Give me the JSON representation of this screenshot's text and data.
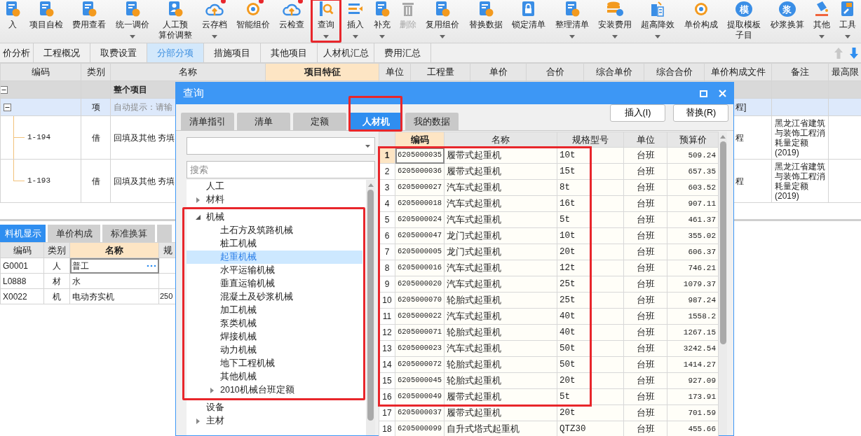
{
  "toolbar": [
    {
      "lines": [
        "入"
      ],
      "kind": "document",
      "dropdown": false,
      "disabled": false,
      "alert": false,
      "highlighted": false
    },
    {
      "lines": [
        "项目自检"
      ],
      "kind": "document",
      "dropdown": false,
      "disabled": false,
      "alert": false,
      "highlighted": false
    },
    {
      "lines": [
        "费用查看"
      ],
      "kind": "document",
      "dropdown": false,
      "disabled": false,
      "alert": false,
      "highlighted": false
    },
    {
      "lines": [
        "统一调价"
      ],
      "kind": "document",
      "dropdown": true,
      "disabled": false,
      "alert": false,
      "highlighted": false
    },
    {
      "lines": [
        "人工预",
        "算价调整"
      ],
      "kind": "person",
      "dropdown": false,
      "disabled": false,
      "alert": false,
      "highlighted": false
    },
    {
      "lines": [
        "云存档"
      ],
      "kind": "cloud",
      "dropdown": true,
      "disabled": false,
      "alert": true,
      "highlighted": false
    },
    {
      "lines": [
        "智能组价"
      ],
      "kind": "coin",
      "dropdown": false,
      "disabled": false,
      "alert": true,
      "highlighted": false
    },
    {
      "lines": [
        "云检查"
      ],
      "kind": "cloud",
      "dropdown": false,
      "disabled": false,
      "alert": true,
      "highlighted": false
    },
    {
      "lines": [
        "查询"
      ],
      "kind": "search",
      "dropdown": true,
      "disabled": false,
      "alert": false,
      "highlighted": true
    },
    {
      "lines": [
        "插入"
      ],
      "kind": "list",
      "dropdown": true,
      "disabled": false,
      "alert": false,
      "highlighted": false
    },
    {
      "lines": [
        "补充"
      ],
      "kind": "document",
      "dropdown": true,
      "disabled": false,
      "alert": false,
      "highlighted": false
    },
    {
      "lines": [
        "删除"
      ],
      "kind": "trash",
      "dropdown": false,
      "disabled": true,
      "alert": false,
      "highlighted": false
    },
    {
      "lines": [
        "复用组价"
      ],
      "kind": "document",
      "dropdown": true,
      "disabled": false,
      "alert": false,
      "highlighted": false
    },
    {
      "lines": [
        "替换数据"
      ],
      "kind": "document",
      "dropdown": false,
      "disabled": false,
      "alert": false,
      "highlighted": false
    },
    {
      "lines": [
        "锁定清单"
      ],
      "kind": "lock",
      "dropdown": false,
      "disabled": false,
      "alert": false,
      "highlighted": false
    },
    {
      "lines": [
        "整理清单"
      ],
      "kind": "document",
      "dropdown": true,
      "disabled": false,
      "alert": false,
      "highlighted": false
    },
    {
      "lines": [
        "安装费用"
      ],
      "kind": "database",
      "dropdown": true,
      "disabled": false,
      "alert": false,
      "highlighted": false
    },
    {
      "lines": [
        "超高降效"
      ],
      "kind": "building",
      "dropdown": true,
      "disabled": false,
      "alert": false,
      "highlighted": false
    },
    {
      "lines": [
        "单价构成"
      ],
      "kind": "coin",
      "dropdown": false,
      "disabled": false,
      "alert": false,
      "highlighted": false
    },
    {
      "lines": [
        "提取模板",
        "子目"
      ],
      "kind": "letter",
      "icon_text": "模",
      "dropdown": false,
      "disabled": false,
      "alert": false,
      "highlighted": false
    },
    {
      "lines": [
        "砂浆换算"
      ],
      "kind": "letter",
      "icon_text": "浆",
      "dropdown": false,
      "disabled": false,
      "alert": false,
      "highlighted": false
    },
    {
      "lines": [
        "其他"
      ],
      "kind": "bucket",
      "dropdown": true,
      "disabled": false,
      "alert": false,
      "highlighted": false
    },
    {
      "lines": [
        "工具"
      ],
      "kind": "tool",
      "dropdown": true,
      "disabled": false,
      "alert": false,
      "highlighted": false
    }
  ],
  "view_tabs": [
    {
      "label": "价分析",
      "selected": false
    },
    {
      "label": "工程概况",
      "selected": false
    },
    {
      "label": "取费设置",
      "selected": false
    },
    {
      "label": "分部分项",
      "selected": true
    },
    {
      "label": "措施项目",
      "selected": false
    },
    {
      "label": "其他项目",
      "selected": false
    },
    {
      "label": "人材机汇总",
      "selected": false
    },
    {
      "label": "费用汇总",
      "selected": false
    }
  ],
  "main_grid": {
    "columns": [
      {
        "label": "编码",
        "current": false
      },
      {
        "label": "类别",
        "current": false
      },
      {
        "label": "名称",
        "current": false
      },
      {
        "label": "项目特征",
        "current": true
      },
      {
        "label": "单位",
        "current": false
      },
      {
        "label": "工程量",
        "current": false
      },
      {
        "label": "单价",
        "current": false
      },
      {
        "label": "合价",
        "current": false
      },
      {
        "label": "综合单价",
        "current": false
      },
      {
        "label": "综合合价",
        "current": false
      },
      {
        "label": "单价构成文件",
        "current": false
      },
      {
        "label": "备注",
        "current": false
      },
      {
        "label": "最高限",
        "current": false
      }
    ],
    "rows": [
      {
        "kind": "project",
        "name": "整个项目",
        "expanded": true,
        "selected": false
      },
      {
        "kind": "section",
        "type": "项",
        "name": "自动提示：请输",
        "file": "程]",
        "expanded": true,
        "selected": true
      },
      {
        "kind": "item",
        "code": "1-194",
        "type": "借",
        "name": "回填及其他 夯填",
        "file": "程",
        "note": "黑龙江省建筑与装饰工程消耗量定额(2019)",
        "selected": false
      },
      {
        "kind": "item",
        "code": "1-193",
        "type": "借",
        "name": "回填及其他 夯填",
        "file": "程",
        "note": "黑龙江省建筑与装饰工程消耗量定额(2019)",
        "selected": false
      }
    ]
  },
  "detail_tabs": [
    {
      "label": "料机显示",
      "selected": true
    },
    {
      "label": "单价构成",
      "selected": false
    },
    {
      "label": "标准换算",
      "selected": false
    }
  ],
  "detail_grid": {
    "columns": [
      {
        "label": "编码",
        "current": false
      },
      {
        "label": "类别",
        "current": false
      },
      {
        "label": "名称",
        "current": true
      },
      {
        "label": "规",
        "current": false
      }
    ],
    "rows": [
      {
        "code": "G0001",
        "type": "人",
        "name": "普工",
        "editing": true
      },
      {
        "code": "L0888",
        "type": "材",
        "name": "水",
        "editing": false
      },
      {
        "code": "X0022",
        "type": "机",
        "name": "电动夯实机",
        "spec": "250",
        "editing": false
      }
    ]
  },
  "dialog": {
    "title": "查询",
    "tabs": [
      {
        "label": "清单指引",
        "selected": false,
        "highlighted": false
      },
      {
        "label": "清单",
        "selected": false,
        "highlighted": false
      },
      {
        "label": "定额",
        "selected": false,
        "highlighted": false
      },
      {
        "label": "人材机",
        "selected": true,
        "highlighted": true
      },
      {
        "label": "我的数据",
        "selected": false,
        "highlighted": false
      }
    ],
    "buttons": [
      "插入(I)",
      "替换(R)"
    ],
    "search": {
      "placeholder": "搜索"
    },
    "tree": [
      {
        "label": "人工",
        "kind": "leaf",
        "selected": false,
        "highlighted": false
      },
      {
        "label": "材料",
        "kind": "folder",
        "expanded": false,
        "selected": false,
        "highlighted": false
      },
      {
        "label": "机械",
        "kind": "folder",
        "expanded": true,
        "selected": false,
        "highlighted": true,
        "children": [
          {
            "label": "土石方及筑路机械",
            "kind": "leaf",
            "selected": false
          },
          {
            "label": "桩工机械",
            "kind": "leaf",
            "selected": false
          },
          {
            "label": "起重机械",
            "kind": "leaf",
            "selected": true
          },
          {
            "label": "水平运输机械",
            "kind": "leaf",
            "selected": false
          },
          {
            "label": "垂直运输机械",
            "kind": "leaf",
            "selected": false
          },
          {
            "label": "混凝土及砂浆机械",
            "kind": "leaf",
            "selected": false
          },
          {
            "label": "加工机械",
            "kind": "leaf",
            "selected": false
          },
          {
            "label": "泵类机械",
            "kind": "leaf",
            "selected": false
          },
          {
            "label": "焊接机械",
            "kind": "leaf",
            "selected": false
          },
          {
            "label": "动力机械",
            "kind": "leaf",
            "selected": false
          },
          {
            "label": "地下工程机械",
            "kind": "leaf",
            "selected": false
          },
          {
            "label": "其他机械",
            "kind": "leaf",
            "selected": false
          },
          {
            "label": "2010机械台班定额",
            "kind": "folder",
            "expanded": false,
            "selected": false
          }
        ]
      },
      {
        "label": "设备",
        "kind": "leaf",
        "selected": false,
        "highlighted": false
      },
      {
        "label": "主材",
        "kind": "folder",
        "expanded": false,
        "selected": false,
        "highlighted": false
      }
    ],
    "columns": [
      {
        "label": "编码",
        "current": true
      },
      {
        "label": "名称",
        "current": false
      },
      {
        "label": "规格型号",
        "current": false
      },
      {
        "label": "单位",
        "current": false
      },
      {
        "label": "预算价",
        "current": false
      }
    ],
    "rows": [
      {
        "no": "1",
        "code": "6205000035",
        "name": "履带式起重机",
        "spec": "10t",
        "unit": "台班",
        "price": "509.24",
        "selected": true,
        "highlighted": true
      },
      {
        "no": "2",
        "code": "6205000036",
        "name": "履带式起重机",
        "spec": "15t",
        "unit": "台班",
        "price": "657.35",
        "selected": false,
        "highlighted": true
      },
      {
        "no": "3",
        "code": "6205000027",
        "name": "汽车式起重机",
        "spec": "8t",
        "unit": "台班",
        "price": "603.52",
        "selected": false,
        "highlighted": true
      },
      {
        "no": "4",
        "code": "6205000018",
        "name": "汽车式起重机",
        "spec": "16t",
        "unit": "台班",
        "price": "907.11",
        "selected": false,
        "highlighted": true
      },
      {
        "no": "5",
        "code": "6205000024",
        "name": "汽车式起重机",
        "spec": "5t",
        "unit": "台班",
        "price": "461.37",
        "selected": false,
        "highlighted": true
      },
      {
        "no": "6",
        "code": "6205000047",
        "name": "龙门式起重机",
        "spec": "10t",
        "unit": "台班",
        "price": "355.02",
        "selected": false,
        "highlighted": true
      },
      {
        "no": "7",
        "code": "6205000005",
        "name": "龙门式起重机",
        "spec": "20t",
        "unit": "台班",
        "price": "606.37",
        "selected": false,
        "highlighted": true
      },
      {
        "no": "8",
        "code": "6205000016",
        "name": "汽车式起重机",
        "spec": "12t",
        "unit": "台班",
        "price": "746.21",
        "selected": false,
        "highlighted": true
      },
      {
        "no": "9",
        "code": "6205000020",
        "name": "汽车式起重机",
        "spec": "25t",
        "unit": "台班",
        "price": "1079.37",
        "selected": false,
        "highlighted": true
      },
      {
        "no": "10",
        "code": "6205000070",
        "name": "轮胎式起重机",
        "spec": "25t",
        "unit": "台班",
        "price": "987.24",
        "selected": false,
        "highlighted": true
      },
      {
        "no": "11",
        "code": "6205000022",
        "name": "汽车式起重机",
        "spec": "40t",
        "unit": "台班",
        "price": "1558.2",
        "selected": false,
        "highlighted": true
      },
      {
        "no": "12",
        "code": "6205000071",
        "name": "轮胎式起重机",
        "spec": "40t",
        "unit": "台班",
        "price": "1267.15",
        "selected": false,
        "highlighted": true
      },
      {
        "no": "13",
        "code": "6205000023",
        "name": "汽车式起重机",
        "spec": "50t",
        "unit": "台班",
        "price": "3242.54",
        "selected": false,
        "highlighted": true
      },
      {
        "no": "14",
        "code": "6205000072",
        "name": "轮胎式起重机",
        "spec": "50t",
        "unit": "台班",
        "price": "1414.27",
        "selected": false,
        "highlighted": true
      },
      {
        "no": "15",
        "code": "6205000045",
        "name": "轮胎式起重机",
        "spec": "20t",
        "unit": "台班",
        "price": "927.09",
        "selected": false,
        "highlighted": true
      },
      {
        "no": "16",
        "code": "6205000049",
        "name": "履带式起重机",
        "spec": "5t",
        "unit": "台班",
        "price": "173.91",
        "selected": false,
        "highlighted": true
      },
      {
        "no": "17",
        "code": "6205000037",
        "name": "履带式起重机",
        "spec": "20t",
        "unit": "台班",
        "price": "701.59",
        "selected": false,
        "highlighted": false
      },
      {
        "no": "18",
        "code": "6205000099",
        "name": "自升式塔式起重机",
        "spec": "QTZ30",
        "unit": "台班",
        "price": "455.66",
        "selected": false,
        "highlighted": false
      }
    ]
  }
}
